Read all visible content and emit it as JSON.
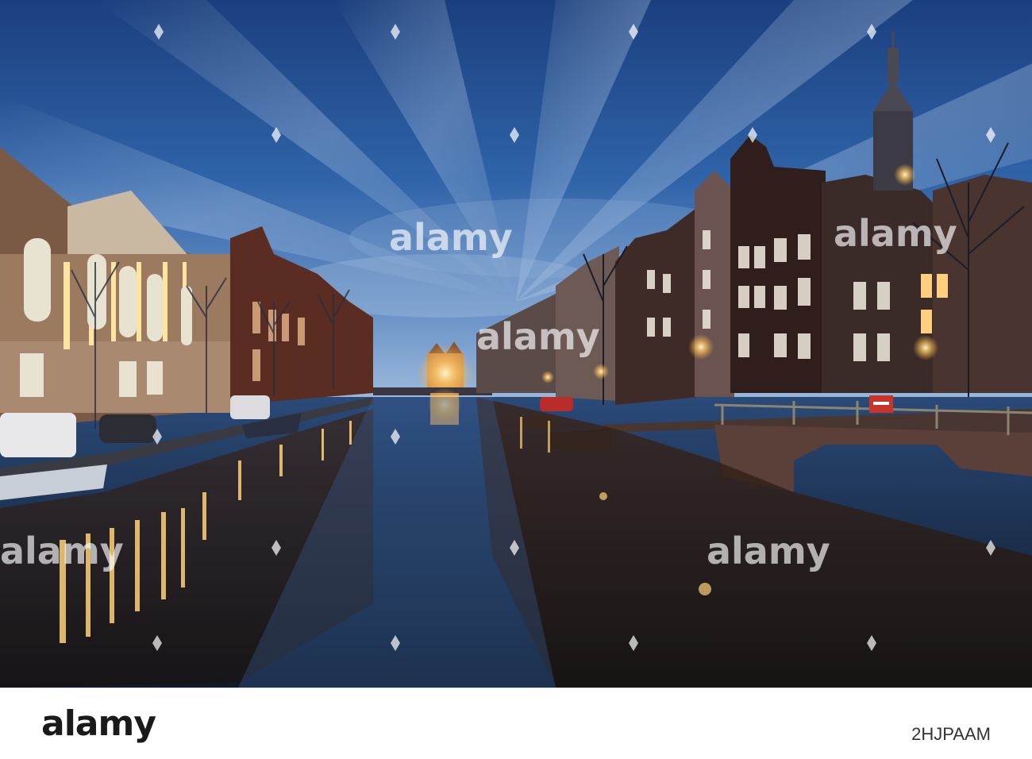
{
  "scene": {
    "description_colors": {
      "sky_top": "#1d4a8e",
      "sky_mid": "#3a6fb6",
      "horizon": "#8fb1d8",
      "water": "#16273f",
      "light_glow": "#ffc866",
      "brick": "#4a2a22"
    }
  },
  "watermark": {
    "text": "alamy"
  },
  "footer": {
    "logo": "alamy",
    "image_id": "2HJPAAM"
  }
}
